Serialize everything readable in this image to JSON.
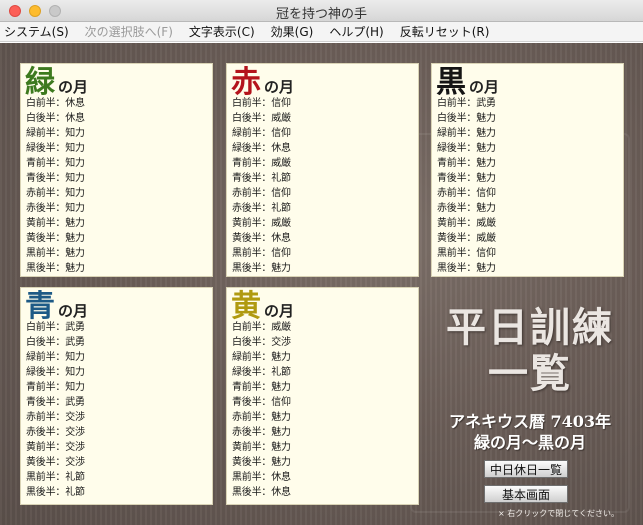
{
  "window": {
    "title": "冠を持つ神の手"
  },
  "menu": [
    {
      "label": "システム(S)",
      "enabled": true
    },
    {
      "label": "次の選択肢へ(F)",
      "enabled": false
    },
    {
      "label": "文字表示(C)",
      "enabled": true
    },
    {
      "label": "効果(G)",
      "enabled": true
    },
    {
      "label": "ヘルプ(H)",
      "enabled": true
    },
    {
      "label": "反転リセット(R)",
      "enabled": true
    }
  ],
  "suffix": "の月",
  "panels": [
    {
      "kanji": "緑",
      "color": "#3d7a1f",
      "rows": [
        "白前半：休息",
        "白後半：休息",
        "緑前半：知力",
        "緑後半：知力",
        "青前半：知力",
        "青後半：知力",
        "赤前半：知力",
        "赤後半：知力",
        "黄前半：魅力",
        "黄後半：魅力",
        "黒前半：魅力",
        "黒後半：魅力"
      ]
    },
    {
      "kanji": "赤",
      "color": "#b4141c",
      "rows": [
        "白前半：信仰",
        "白後半：威厳",
        "緑前半：信仰",
        "緑後半：休息",
        "青前半：威厳",
        "青後半：礼節",
        "赤前半：信仰",
        "赤後半：礼節",
        "黄前半：威厳",
        "黄後半：休息",
        "黒前半：信仰",
        "黒後半：魅力"
      ]
    },
    {
      "kanji": "黒",
      "color": "#151515",
      "rows": [
        "白前半：武勇",
        "白後半：魅力",
        "緑前半：魅力",
        "緑後半：魅力",
        "青前半：魅力",
        "青後半：魅力",
        "赤前半：信仰",
        "赤後半：魅力",
        "黄前半：威厳",
        "黄後半：威厳",
        "黒前半：信仰",
        "黒後半：魅力"
      ]
    },
    {
      "kanji": "青",
      "color": "#1d5a86",
      "rows": [
        "白前半：武勇",
        "白後半：武勇",
        "緑前半：知力",
        "緑後半：知力",
        "青前半：知力",
        "青後半：武勇",
        "赤前半：交渉",
        "赤後半：交渉",
        "黄前半：交渉",
        "黄後半：交渉",
        "黒前半：礼節",
        "黒後半：礼節"
      ]
    },
    {
      "kanji": "黄",
      "color": "#b09a10",
      "rows": [
        "白前半：威厳",
        "白後半：交渉",
        "緑前半：魅力",
        "緑後半：礼節",
        "青前半：魅力",
        "青後半：信仰",
        "赤前半：魅力",
        "赤後半：魅力",
        "黄前半：魅力",
        "黄後半：魅力",
        "黒前半：休息",
        "黒後半：休息"
      ]
    }
  ],
  "side": {
    "title_line1": "平日訓練",
    "title_line2": "一覧",
    "period_line1": "アネキウス暦 7403年",
    "period_line2": "緑の月～黒の月",
    "btn_holiday": "中日休日一覧",
    "btn_main": "基本画面",
    "hint": "× 右クリックで閉じてください。"
  }
}
